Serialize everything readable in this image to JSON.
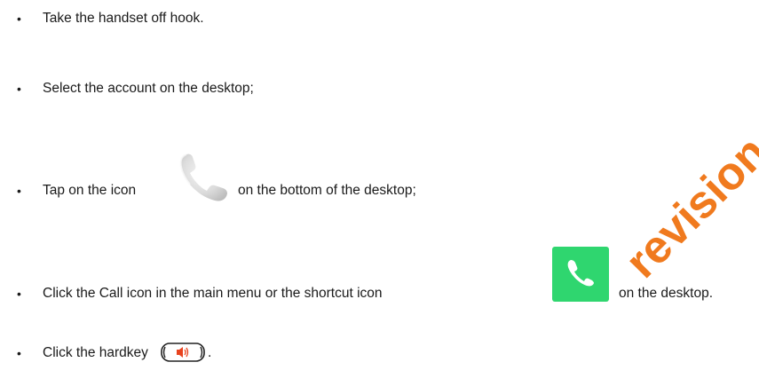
{
  "items": [
    {
      "bullet": "•",
      "text": "Take the handset off hook."
    },
    {
      "bullet": "•",
      "text": "Select the account on the desktop;"
    },
    {
      "bullet": "•",
      "text_before": "Tap on the icon",
      "text_after": "on the bottom of the desktop;",
      "icon": "phone-handset-icon"
    },
    {
      "bullet": "•",
      "text_before": "Click the Call icon in the main menu or the shortcut icon",
      "text_after": "on the desktop.",
      "icon": "call-app-icon"
    },
    {
      "bullet": "•",
      "text_before": "Click the hardkey",
      "text_after": ".",
      "icon": "speaker-hardkey-icon"
    }
  ],
  "watermark": "revision",
  "colors": {
    "call_green": "#2fd66f",
    "watermark_orange": "#f07a1e",
    "hardkey_red": "#e8431f"
  }
}
